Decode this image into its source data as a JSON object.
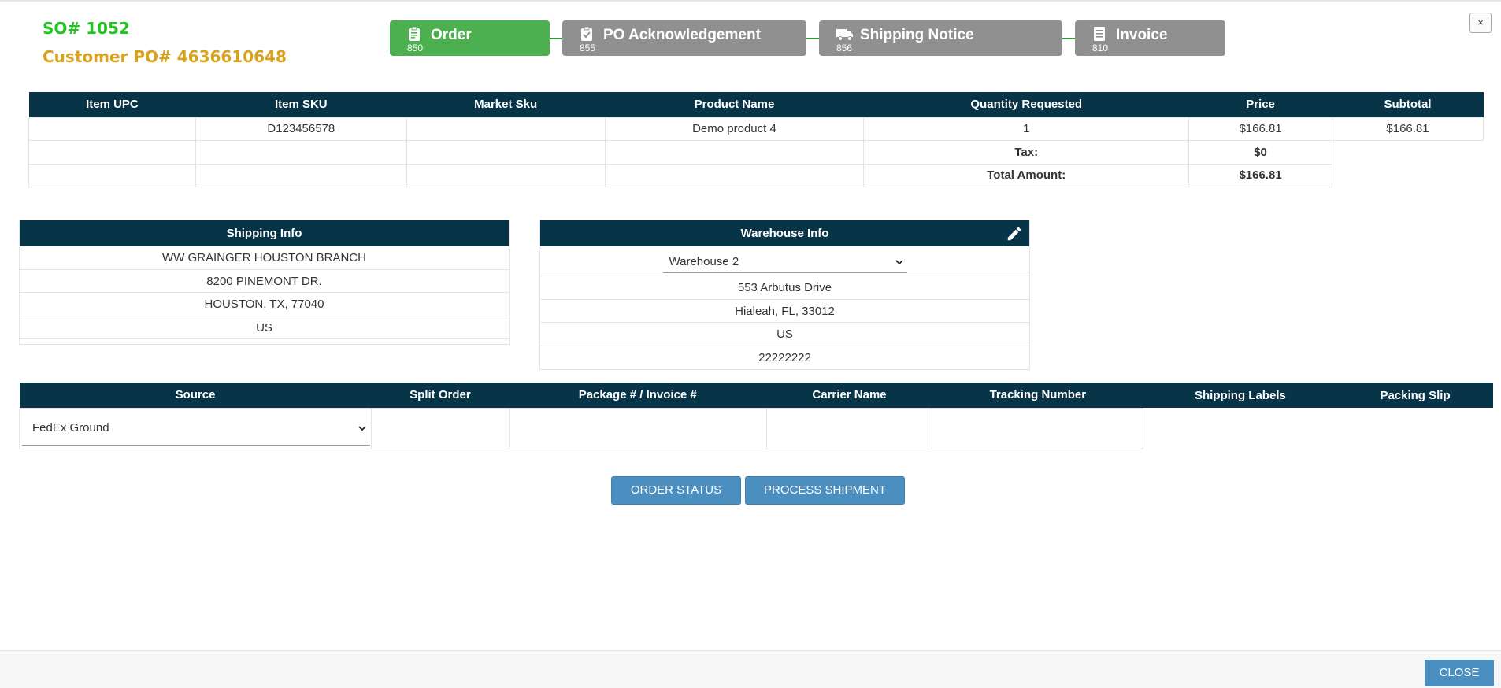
{
  "header": {
    "so_number": "SO# 1052",
    "customer_po": "Customer PO# 4636610648",
    "close_icon_label": "×"
  },
  "steps": [
    {
      "label": "Order",
      "count": "850",
      "icon": "clipboard-icon",
      "active": true
    },
    {
      "label": "PO Acknowledgement",
      "count": "855",
      "icon": "clipboard-check-icon",
      "active": false
    },
    {
      "label": "Shipping Notice",
      "count": "856",
      "icon": "truck-icon",
      "active": false
    },
    {
      "label": "Invoice",
      "count": "810",
      "icon": "document-icon",
      "active": false
    }
  ],
  "items_table": {
    "headers": [
      "Item UPC",
      "Item SKU",
      "Market Sku",
      "Product Name",
      "Quantity Requested",
      "Price",
      "Subtotal"
    ],
    "rows": [
      {
        "upc": "",
        "sku": "D123456578",
        "market_sku": "",
        "product_name": "Demo product 4",
        "quantity": "1",
        "price": "$166.81",
        "subtotal": "$166.81"
      }
    ],
    "tax_label": "Tax:",
    "tax_value": "$0",
    "total_label": "Total Amount:",
    "total_value": "$166.81"
  },
  "shipping_info": {
    "title": "Shipping Info",
    "lines": [
      "WW GRAINGER HOUSTON BRANCH",
      "8200 PINEMONT DR.",
      "HOUSTON, TX, 77040",
      "US"
    ]
  },
  "warehouse_info": {
    "title": "Warehouse Info",
    "selected_warehouse": "Warehouse 2",
    "lines": [
      "553 Arbutus Drive",
      "Hialeah, FL, 33012",
      "US",
      "22222222"
    ],
    "edit_icon": "pencil-icon"
  },
  "shipment_table": {
    "headers": [
      "Source",
      "Split Order",
      "Package # / Invoice #",
      "Carrier Name",
      "Tracking Number",
      "Shipping Labels",
      "Packing Slip"
    ],
    "source_selected": "FedEx Ground"
  },
  "actions": {
    "order_status": "ORDER STATUS",
    "process_shipment": "PROCESS SHIPMENT"
  },
  "footer": {
    "close_label": "CLOSE"
  },
  "colors": {
    "header_bg": "#073447",
    "active_step": "#4caf50",
    "inactive_step": "#909090",
    "button": "#4a8fc0",
    "so_number": "#22c422",
    "customer_po": "#d8a31c"
  }
}
